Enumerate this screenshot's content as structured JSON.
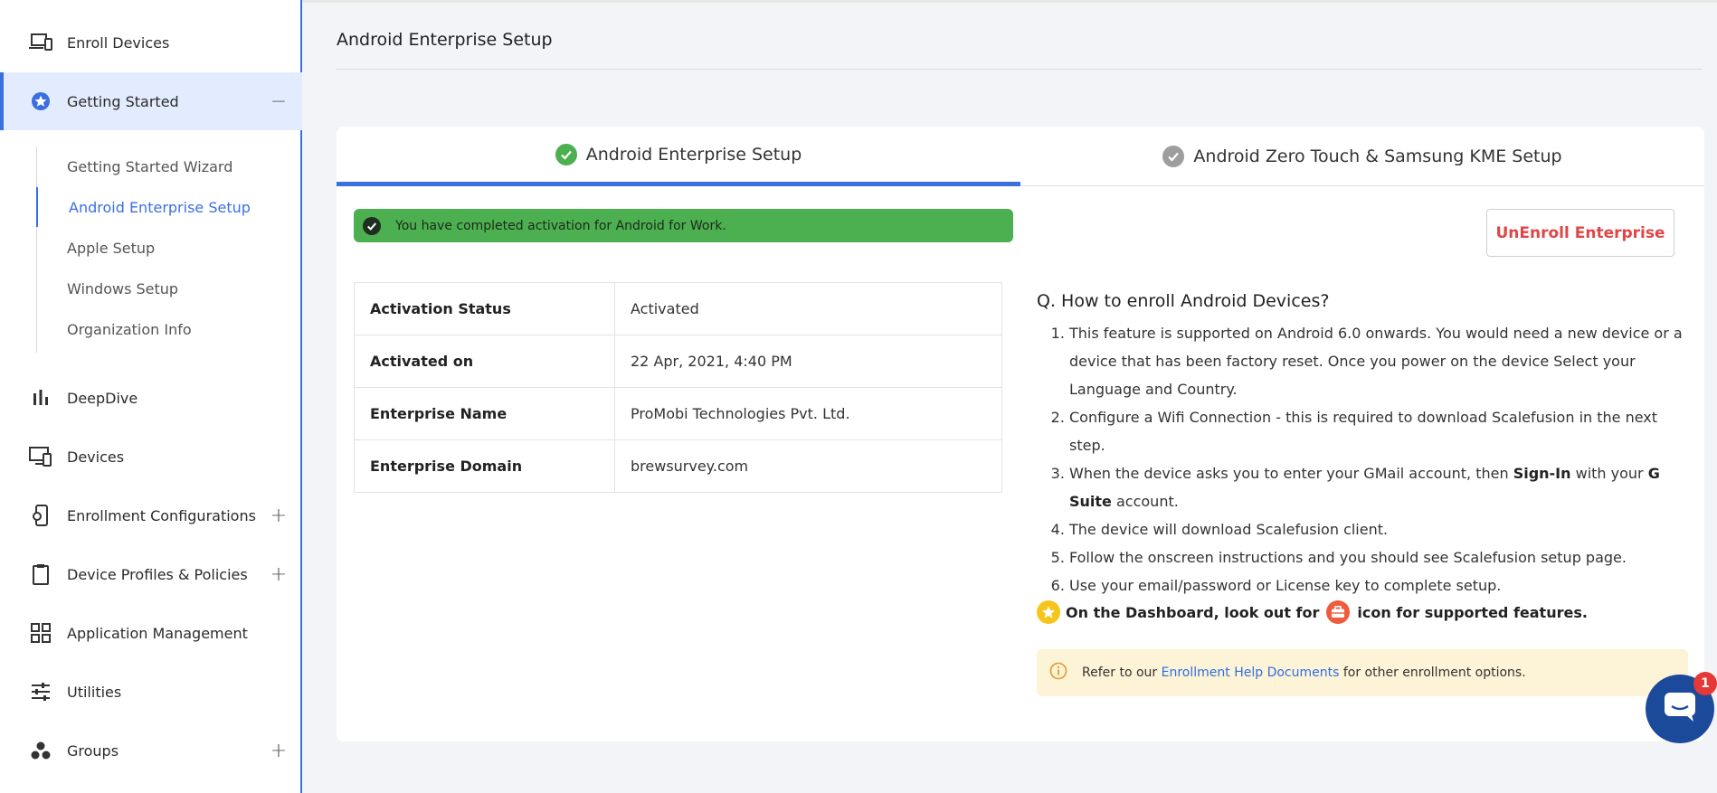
{
  "sidebar": {
    "items": [
      {
        "label": "Enroll Devices",
        "icon": "devices-icon"
      },
      {
        "label": "Getting Started",
        "icon": "star-badge-icon",
        "toggle": "−"
      },
      {
        "label": "DeepDive",
        "icon": "bar-chart-icon"
      },
      {
        "label": "Devices",
        "icon": "monitor-icon"
      },
      {
        "label": "Enrollment Configurations",
        "icon": "phone-gear-icon",
        "toggle": "+"
      },
      {
        "label": "Device Profiles & Policies",
        "icon": "clipboard-icon",
        "toggle": "+"
      },
      {
        "label": "Application Management",
        "icon": "grid-icon"
      },
      {
        "label": "Utilities",
        "icon": "sliders-icon"
      },
      {
        "label": "Groups",
        "icon": "groups-icon",
        "toggle": "+"
      }
    ],
    "subitems": [
      {
        "label": "Getting Started Wizard"
      },
      {
        "label": "Android Enterprise Setup"
      },
      {
        "label": "Apple Setup"
      },
      {
        "label": "Windows Setup"
      },
      {
        "label": "Organization Info"
      }
    ]
  },
  "header": {
    "title": "Android Enterprise Setup"
  },
  "tabs": [
    {
      "label": "Android Enterprise Setup"
    },
    {
      "label": "Android Zero Touch & Samsung KME Setup"
    }
  ],
  "alert": {
    "message": "You have completed activation for Android for Work."
  },
  "unenroll_label": "UnEnroll Enterprise",
  "info_table": [
    {
      "key": "Activation Status",
      "value": "Activated"
    },
    {
      "key": "Activated on",
      "value": "22 Apr, 2021, 4:40 PM"
    },
    {
      "key": "Enterprise Name",
      "value": "ProMobi Technologies Pvt. Ltd."
    },
    {
      "key": "Enterprise Domain",
      "value": "brewsurvey.com"
    }
  ],
  "howto": {
    "title": "Q. How to enroll Android Devices?",
    "steps": [
      "This feature is supported on Android 6.0 onwards. You would need a new device or a device that has been factory reset. Once you power on the device Select your Language and Country.",
      "Configure a Wifi Connection - this is required to download Scalefusion in the next step.",
      {
        "pre": "When the device asks you to enter your GMail account, then ",
        "b1": "Sign-In",
        "mid": " with your ",
        "b2": "G Suite",
        "post": " account."
      },
      "The device will download Scalefusion client.",
      "Follow the onscreen instructions and you should see Scalefusion setup page.",
      "Use your email/password or License key to complete setup."
    ]
  },
  "dashboard_note": {
    "pre": "On the Dashboard, look out for",
    "post": "icon for supported features."
  },
  "help": {
    "pre": "Refer to our ",
    "link": "Enrollment Help Documents",
    "post": " for other enrollment options."
  },
  "chat": {
    "badge": "1"
  },
  "colors": {
    "accent": "#3b6fe0",
    "success": "#4caf50",
    "danger": "#e04646",
    "chat": "#1b4a9b"
  }
}
